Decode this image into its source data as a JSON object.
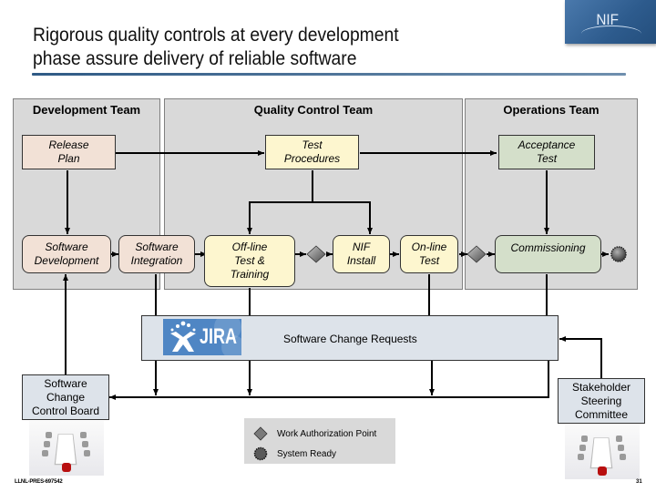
{
  "title": {
    "line1": "Rigorous quality controls at every development",
    "line2": "phase assure delivery of reliable software"
  },
  "logo": {
    "text": "NIF"
  },
  "lanes": {
    "development": "Development Team",
    "quality_control": "Quality Control Team",
    "operations": "Operations Team"
  },
  "boxes": {
    "release_plan": [
      "Release",
      "Plan"
    ],
    "test_procedures": [
      "Test",
      "Procedures"
    ],
    "acceptance_test": [
      "Acceptance",
      "Test"
    ],
    "software_development": [
      "Software",
      "Development"
    ],
    "software_integration": [
      "Software",
      "Integration"
    ],
    "offline_test": [
      "Off-line",
      "Test &",
      "Training"
    ],
    "nif_install": [
      "NIF",
      "Install"
    ],
    "online_test": [
      "On-line",
      "Test"
    ],
    "commissioning": [
      "Commissioning"
    ]
  },
  "jira": {
    "logo_text": "JIRA",
    "label": "Software Change Requests"
  },
  "boards": {
    "sccb": [
      "Software",
      "Change",
      "Control Board"
    ],
    "ssc": [
      "Stakeholder",
      "Steering",
      "Committee"
    ]
  },
  "legend": {
    "items": [
      {
        "icon": "diamond-icon",
        "label": "Work Authorization Point"
      },
      {
        "icon": "gear-circle-icon",
        "label": "System Ready"
      }
    ]
  },
  "footer": {
    "doc_id": "LLNL-PRES-697542",
    "page": "31"
  },
  "colors": {
    "lane_bg": "#d9d9d9",
    "dev_box": "#f2e1d6",
    "qc_box": "#fdf6cf",
    "ops_box": "#d4dfca",
    "jira_bar": "#dde3ea",
    "jira_logo": "#4f86c4",
    "title_rule": "#2f5a85"
  }
}
